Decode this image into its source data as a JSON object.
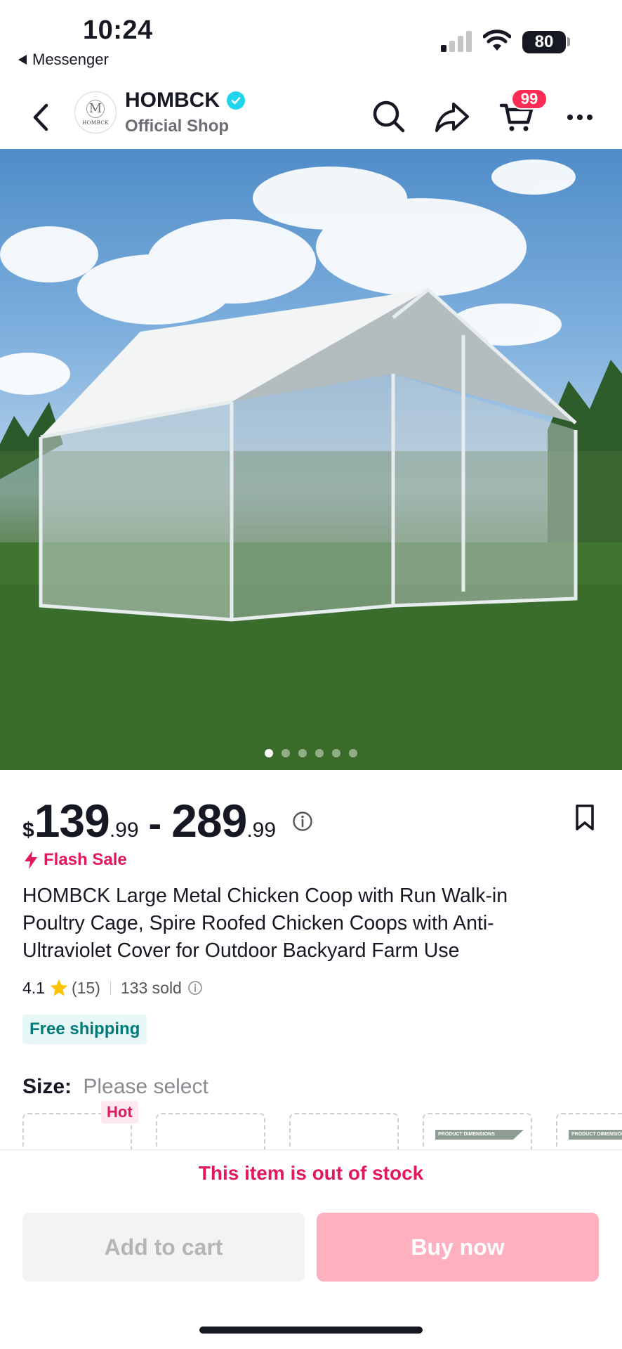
{
  "status_bar": {
    "time": "10:24",
    "back_app": "Messenger",
    "battery": "80"
  },
  "header": {
    "shop_name": "HOMBCK",
    "shop_subtitle": "Official Shop",
    "logo_text": "HOMBCK",
    "logo_mono": "M",
    "cart_badge": "99"
  },
  "gallery": {
    "image_count": 6,
    "active_index": 0
  },
  "product": {
    "price_currency": "$",
    "price_low_whole": "139",
    "price_low_cents": ".99",
    "price_sep": "-",
    "price_high_whole": "289",
    "price_high_cents": ".99",
    "flash_sale": "Flash Sale",
    "title": "HOMBCK Large Metal Chicken Coop with Run Walk-in Poultry Cage, Spire Roofed Chicken Coops with Anti-Ultraviolet Cover for Outdoor Backyard Farm Use",
    "rating": "4.1",
    "review_count": "(15)",
    "sold": "133 sold",
    "shipping": "Free shipping"
  },
  "size": {
    "label": "Size:",
    "value": "Please select",
    "hot_badge": "Hot",
    "dimension_label": "PRODUCT DIMENSIONS"
  },
  "bottom": {
    "out_of_stock": "This item is out of stock",
    "add_to_cart": "Add to cart",
    "buy_now": "Buy now"
  },
  "colors": {
    "accent": "#fe2c55",
    "flash": "#e3175f",
    "shipping_bg": "#e6f7f6",
    "shipping_text": "#007a7a",
    "verified": "#20d5ec",
    "buy_disabled": "#fdb0bf"
  }
}
